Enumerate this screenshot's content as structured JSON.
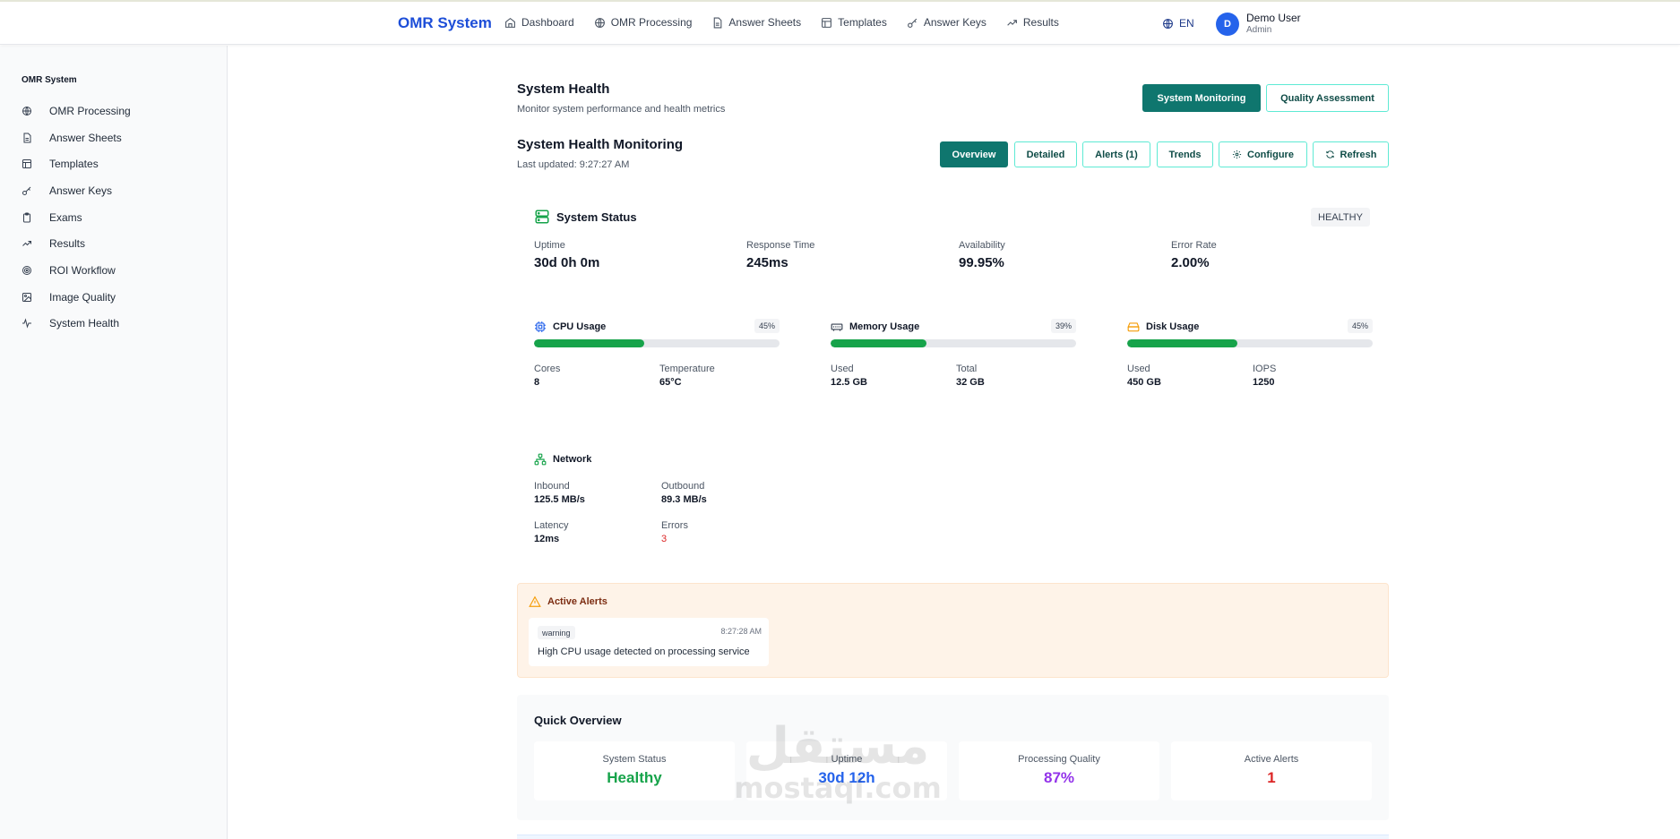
{
  "topbar": {
    "brand": "OMR System",
    "nav": [
      {
        "label": "Dashboard",
        "icon": "home-icon"
      },
      {
        "label": "OMR Processing",
        "icon": "globe-icon"
      },
      {
        "label": "Answer Sheets",
        "icon": "document-icon"
      },
      {
        "label": "Templates",
        "icon": "template-icon"
      },
      {
        "label": "Answer Keys",
        "icon": "key-icon"
      },
      {
        "label": "Results",
        "icon": "trending-up-icon"
      }
    ],
    "language": "EN",
    "user": {
      "initial": "D",
      "name": "Demo User",
      "role": "Admin"
    }
  },
  "sidebar": {
    "title": "OMR System",
    "items": [
      {
        "label": "OMR Processing",
        "icon": "globe-icon"
      },
      {
        "label": "Answer Sheets",
        "icon": "document-icon"
      },
      {
        "label": "Templates",
        "icon": "template-icon"
      },
      {
        "label": "Answer Keys",
        "icon": "key-icon"
      },
      {
        "label": "Exams",
        "icon": "clipboard-icon"
      },
      {
        "label": "Results",
        "icon": "trending-up-icon"
      },
      {
        "label": "ROI Workflow",
        "icon": "target-icon"
      },
      {
        "label": "Image Quality",
        "icon": "image-icon"
      },
      {
        "label": "System Health",
        "icon": "activity-icon"
      }
    ]
  },
  "page": {
    "title": "System Health",
    "subtitle": "Monitor system performance and health metrics",
    "buttons": {
      "monitoring": "System Monitoring",
      "quality": "Quality Assessment"
    }
  },
  "monitoring": {
    "title": "System Health Monitoring",
    "last_updated": "Last updated: 9:27:27 AM",
    "tabs": {
      "overview": "Overview",
      "detailed": "Detailed",
      "alerts": "Alerts (1)",
      "trends": "Trends",
      "configure": "Configure",
      "refresh": "Refresh"
    }
  },
  "status": {
    "title": "System Status",
    "badge": "HEALTHY",
    "metrics": [
      {
        "label": "Uptime",
        "value": "30d 0h 0m"
      },
      {
        "label": "Response Time",
        "value": "245ms"
      },
      {
        "label": "Availability",
        "value": "99.95%"
      },
      {
        "label": "Error Rate",
        "value": "2.00%"
      }
    ]
  },
  "resources": {
    "cpu": {
      "title": "CPU Usage",
      "percent_text": "45%",
      "percent": 45,
      "color": "#2563eb",
      "stats": [
        {
          "label": "Cores",
          "value": "8"
        },
        {
          "label": "Temperature",
          "value": "65°C"
        }
      ]
    },
    "memory": {
      "title": "Memory Usage",
      "percent_text": "39%",
      "percent": 39,
      "color": "#374151",
      "stats": [
        {
          "label": "Used",
          "value": "12.5 GB"
        },
        {
          "label": "Total",
          "value": "32 GB"
        }
      ]
    },
    "disk": {
      "title": "Disk Usage",
      "percent_text": "45%",
      "percent": 45,
      "color": "#f59e0b",
      "stats": [
        {
          "label": "Used",
          "value": "450 GB"
        },
        {
          "label": "IOPS",
          "value": "1250"
        }
      ]
    },
    "bar_color": "#16a34a"
  },
  "network": {
    "title": "Network",
    "stats": [
      {
        "label": "Inbound",
        "value": "125.5 MB/s"
      },
      {
        "label": "Outbound",
        "value": "89.3 MB/s"
      },
      {
        "label": "Latency",
        "value": "12ms"
      },
      {
        "label": "Errors",
        "value": "3"
      }
    ]
  },
  "alerts": {
    "title": "Active Alerts",
    "items": [
      {
        "severity": "warning",
        "time": "8:27:28 AM",
        "message": "High CPU usage detected on processing service"
      }
    ]
  },
  "quick_overview": {
    "title": "Quick Overview",
    "cards": [
      {
        "label": "System Status",
        "value": "Healthy",
        "color": "#16a34a"
      },
      {
        "label": "Uptime",
        "value": "30d 12h",
        "color": "#2563eb"
      },
      {
        "label": "Processing Quality",
        "value": "87%",
        "color": "#9333ea"
      },
      {
        "label": "Active Alerts",
        "value": "1",
        "color": "#dc2626"
      }
    ]
  },
  "watermark": {
    "arabic": "مستقل",
    "latin": "mostaql.com"
  }
}
